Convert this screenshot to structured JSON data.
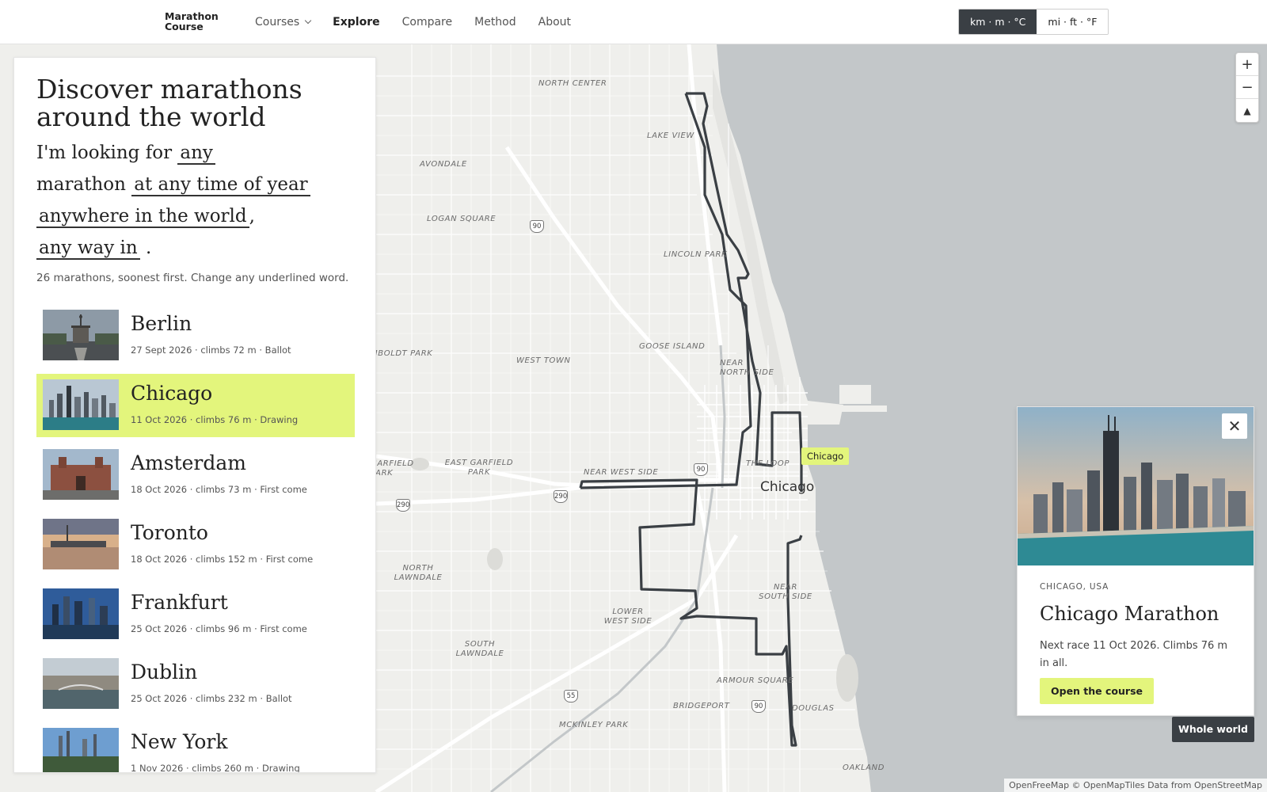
{
  "brand": "Marathon Course",
  "nav": {
    "courses": "Courses",
    "explore": "Explore",
    "compare": "Compare",
    "method": "Method",
    "about": "About"
  },
  "units": {
    "metric": "km · m · °C",
    "imperial": "mi · ft · °F",
    "selected": "metric"
  },
  "panel": {
    "title": "Discover marathons around the world",
    "sentence": {
      "p1": "I'm looking for",
      "w1": "any",
      "p2": "marathon",
      "w2": "at any time of year",
      "w3": "anywhere in the world",
      "p3": ",",
      "w4": "any way in",
      "p4": "."
    },
    "summary": "26 marathons, soonest first. Change any underlined word."
  },
  "races": [
    {
      "name": "Berlin",
      "meta": "27 Sept 2026 · climbs 72 m · Ballot",
      "selected": false
    },
    {
      "name": "Chicago",
      "meta": "11 Oct 2026 · climbs 76 m · Drawing",
      "selected": true
    },
    {
      "name": "Amsterdam",
      "meta": "18 Oct 2026 · climbs 73 m · First come",
      "selected": false
    },
    {
      "name": "Toronto",
      "meta": "18 Oct 2026 · climbs 152 m · First come",
      "selected": false
    },
    {
      "name": "Frankfurt",
      "meta": "25 Oct 2026 · climbs 96 m · First come",
      "selected": false
    },
    {
      "name": "Dublin",
      "meta": "25 Oct 2026 · climbs 232 m · Ballot",
      "selected": false
    },
    {
      "name": "New York",
      "meta": "1 Nov 2026 · climbs 260 m · Drawing",
      "selected": false
    }
  ],
  "map": {
    "labels": {
      "north_center": "NORTH CENTER",
      "lake_view": "LAKE VIEW",
      "avondale": "AVONDALE",
      "logan_square": "LOGAN SQUARE",
      "lincoln_park": "LINCOLN PARK",
      "goose_island": "GOOSE ISLAND",
      "humboldt_park": "HUMBOLDT PARK",
      "west_town": "WEST TOWN",
      "near_north_side": "NEAR NORTH SIDE",
      "the_loop": "THE LOOP",
      "garfield_park": "GARFIELD PARK",
      "east_garfield_park": "EAST GARFIELD PARK",
      "near_west_side": "NEAR WEST SIDE",
      "north_lawndale": "NORTH LAWNDALE",
      "near_south_side": "NEAR SOUTH SIDE",
      "lower_west_side": "LOWER WEST SIDE",
      "south_lawndale": "SOUTH LAWNDALE",
      "armour_square": "ARMOUR SQUARE",
      "bridgeport": "BRIDGEPORT",
      "douglas": "DOUGLAS",
      "mckinley_park": "MCKINLEY PARK",
      "oakland": "OAKLAND"
    },
    "city": "Chicago",
    "shields": {
      "i90": "90",
      "i290": "290",
      "i55": "55"
    },
    "pin": "Chicago",
    "zoom_in": "+",
    "zoom_out": "−",
    "compass": "▲",
    "attribution": "OpenFreeMap © OpenMapTiles Data from OpenStreetMap"
  },
  "card": {
    "location": "CHICAGO, USA",
    "title": "Chicago Marathon",
    "description": "Next race 11 Oct 2026. Climbs 76 m in all.",
    "button": "Open the course",
    "close": "✕"
  },
  "whole_world": "Whole world",
  "colors": {
    "accent": "#e3f57c",
    "dark": "#3a3f44",
    "water": "#c3c7c9",
    "route": "#3a3f44"
  }
}
